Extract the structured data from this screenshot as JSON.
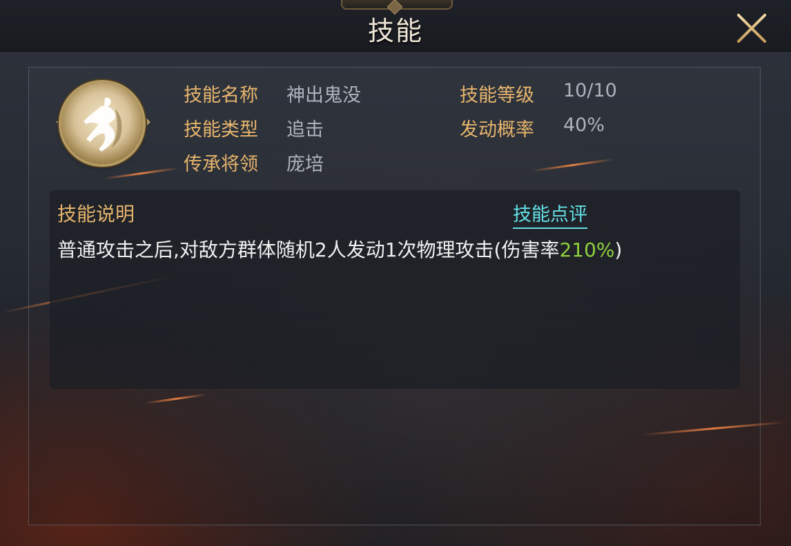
{
  "header": {
    "title": "技能"
  },
  "skill": {
    "labels": {
      "name": "技能名称",
      "level": "技能等级",
      "type": "技能类型",
      "trigger_rate": "发动概率",
      "inherit": "传承将领"
    },
    "values": {
      "name": "神出鬼没",
      "level": "10/10",
      "type": "追击",
      "trigger_rate": "40%",
      "inherit": "庞培"
    }
  },
  "description": {
    "title": "技能说明",
    "review_link": "技能点评",
    "text_before": "普通攻击之后,对敌方群体随机2人发动1次物理攻击(伤害率",
    "highlight": "210%",
    "text_after": ")"
  },
  "colors": {
    "label": "#e7b56d",
    "value": "#aeb4bd",
    "highlight": "#8fd23e",
    "link": "#62e0e6"
  },
  "icons": {
    "close": "close-icon",
    "skill": "skill-icon"
  }
}
